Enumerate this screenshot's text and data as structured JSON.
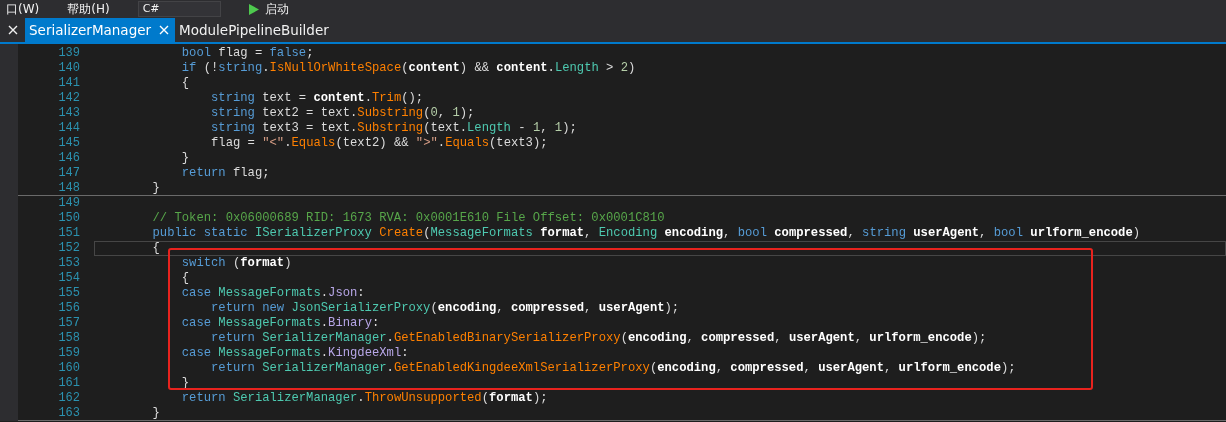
{
  "toolbar": {
    "menus": [
      "口(W)",
      "帮助(H)"
    ],
    "language": "C#",
    "run_label": "启动"
  },
  "tabs": [
    {
      "label": "SerializerManager",
      "selected": true,
      "closable": true
    },
    {
      "label": "ModulePipelineBuilder",
      "selected": false,
      "closable": false
    }
  ],
  "code_lines": [
    {
      "number": "139",
      "current": false,
      "boxed": false,
      "rule_after": false,
      "tokens": [
        {
          "text": "            bool",
          "kind": "kw"
        },
        {
          "text": " flag = ",
          "kind": "p"
        },
        {
          "text": "false",
          "kind": "kw"
        },
        {
          "text": ";",
          "kind": "p"
        }
      ]
    },
    {
      "number": "140",
      "current": false,
      "boxed": false,
      "rule_after": false,
      "tokens": [
        {
          "text": "            if",
          "kind": "kw"
        },
        {
          "text": " (!",
          "kind": "p"
        },
        {
          "text": "string",
          "kind": "kw"
        },
        {
          "text": ".",
          "kind": "p"
        },
        {
          "text": "IsNullOrWhiteSpace",
          "kind": "m"
        },
        {
          "text": "(",
          "kind": "p"
        },
        {
          "text": "content",
          "kind": "b"
        },
        {
          "text": ") && ",
          "kind": "p"
        },
        {
          "text": "content",
          "kind": "b"
        },
        {
          "text": ".",
          "kind": "p"
        },
        {
          "text": "Length",
          "kind": "t"
        },
        {
          "text": " > ",
          "kind": "p"
        },
        {
          "text": "2",
          "kind": "n"
        },
        {
          "text": ")",
          "kind": "p"
        }
      ]
    },
    {
      "number": "141",
      "current": false,
      "boxed": false,
      "rule_after": false,
      "tokens": [
        {
          "text": "            {",
          "kind": "p"
        }
      ]
    },
    {
      "number": "142",
      "current": false,
      "boxed": false,
      "rule_after": false,
      "tokens": [
        {
          "text": "                string",
          "kind": "kw"
        },
        {
          "text": " text = ",
          "kind": "p"
        },
        {
          "text": "content",
          "kind": "b"
        },
        {
          "text": ".",
          "kind": "p"
        },
        {
          "text": "Trim",
          "kind": "m"
        },
        {
          "text": "();",
          "kind": "p"
        }
      ]
    },
    {
      "number": "143",
      "current": false,
      "boxed": false,
      "rule_after": false,
      "tokens": [
        {
          "text": "                string",
          "kind": "kw"
        },
        {
          "text": " text2 = text.",
          "kind": "p"
        },
        {
          "text": "Substring",
          "kind": "m"
        },
        {
          "text": "(",
          "kind": "p"
        },
        {
          "text": "0",
          "kind": "n"
        },
        {
          "text": ", ",
          "kind": "p"
        },
        {
          "text": "1",
          "kind": "n"
        },
        {
          "text": ");",
          "kind": "p"
        }
      ]
    },
    {
      "number": "144",
      "current": false,
      "boxed": false,
      "rule_after": false,
      "tokens": [
        {
          "text": "                string",
          "kind": "kw"
        },
        {
          "text": " text3 = text.",
          "kind": "p"
        },
        {
          "text": "Substring",
          "kind": "m"
        },
        {
          "text": "(text.",
          "kind": "p"
        },
        {
          "text": "Length",
          "kind": "t"
        },
        {
          "text": " - ",
          "kind": "p"
        },
        {
          "text": "1",
          "kind": "n"
        },
        {
          "text": ", ",
          "kind": "p"
        },
        {
          "text": "1",
          "kind": "n"
        },
        {
          "text": ");",
          "kind": "p"
        }
      ]
    },
    {
      "number": "145",
      "current": false,
      "boxed": false,
      "rule_after": false,
      "tokens": [
        {
          "text": "                flag = ",
          "kind": "p"
        },
        {
          "text": "\"<\"",
          "kind": "s"
        },
        {
          "text": ".",
          "kind": "p"
        },
        {
          "text": "Equals",
          "kind": "m"
        },
        {
          "text": "(text2) && ",
          "kind": "p"
        },
        {
          "text": "\">\"",
          "kind": "s"
        },
        {
          "text": ".",
          "kind": "p"
        },
        {
          "text": "Equals",
          "kind": "m"
        },
        {
          "text": "(text3);",
          "kind": "p"
        }
      ]
    },
    {
      "number": "146",
      "current": false,
      "boxed": false,
      "rule_after": false,
      "tokens": [
        {
          "text": "            }",
          "kind": "p"
        }
      ]
    },
    {
      "number": "147",
      "current": false,
      "boxed": false,
      "rule_after": false,
      "tokens": [
        {
          "text": "            return",
          "kind": "kw"
        },
        {
          "text": " flag;",
          "kind": "p"
        }
      ]
    },
    {
      "number": "148",
      "current": false,
      "boxed": false,
      "rule_after": true,
      "tokens": [
        {
          "text": "        }",
          "kind": "p"
        }
      ]
    },
    {
      "number": "149",
      "current": false,
      "boxed": false,
      "rule_after": false
    },
    {
      "number": "150",
      "current": false,
      "boxed": false,
      "rule_after": false,
      "tokens": [
        {
          "text": "        // Token: 0x06000689 RID: 1673 RVA: 0x0001E610 File Offset: 0x0001C810",
          "kind": "c"
        }
      ]
    },
    {
      "number": "151",
      "current": false,
      "boxed": false,
      "rule_after": false,
      "tokens": [
        {
          "text": "        public static",
          "kind": "kw"
        },
        {
          "text": " ISerializerProxy",
          "kind": "t"
        },
        {
          "text": " Create",
          "kind": "m"
        },
        {
          "text": "(",
          "kind": "p"
        },
        {
          "text": "MessageFormats",
          "kind": "t"
        },
        {
          "text": " format",
          "kind": "b"
        },
        {
          "text": ", ",
          "kind": "p"
        },
        {
          "text": "Encoding",
          "kind": "t"
        },
        {
          "text": " encoding",
          "kind": "b"
        },
        {
          "text": ", ",
          "kind": "p"
        },
        {
          "text": "bool",
          "kind": "kw"
        },
        {
          "text": " compressed",
          "kind": "b"
        },
        {
          "text": ", ",
          "kind": "p"
        },
        {
          "text": "string",
          "kind": "kw"
        },
        {
          "text": " userAgent",
          "kind": "b"
        },
        {
          "text": ", ",
          "kind": "p"
        },
        {
          "text": "bool",
          "kind": "kw"
        },
        {
          "text": " urlform_encode",
          "kind": "b"
        },
        {
          "text": ")",
          "kind": "p"
        }
      ]
    },
    {
      "number": "152",
      "current": true,
      "boxed": false,
      "rule_after": false,
      "tokens": [
        {
          "text": "        {",
          "kind": "p"
        }
      ]
    },
    {
      "number": "153",
      "current": false,
      "boxed": true,
      "rule_after": false,
      "tokens": [
        {
          "text": "            switch",
          "kind": "kw"
        },
        {
          "text": " (",
          "kind": "p"
        },
        {
          "text": "format",
          "kind": "b"
        },
        {
          "text": ")",
          "kind": "p"
        }
      ]
    },
    {
      "number": "154",
      "current": false,
      "boxed": true,
      "rule_after": false,
      "tokens": [
        {
          "text": "            {",
          "kind": "p"
        }
      ]
    },
    {
      "number": "155",
      "current": false,
      "boxed": true,
      "rule_after": false,
      "tokens": [
        {
          "text": "            case",
          "kind": "kw"
        },
        {
          "text": " MessageFormats",
          "kind": "t"
        },
        {
          "text": ".",
          "kind": "p"
        },
        {
          "text": "Json",
          "kind": "e"
        },
        {
          "text": ":",
          "kind": "p"
        }
      ]
    },
    {
      "number": "156",
      "current": false,
      "boxed": true,
      "rule_after": false,
      "tokens": [
        {
          "text": "                return new",
          "kind": "kw"
        },
        {
          "text": " JsonSerializerProxy",
          "kind": "t"
        },
        {
          "text": "(",
          "kind": "p"
        },
        {
          "text": "encoding",
          "kind": "b"
        },
        {
          "text": ", ",
          "kind": "p"
        },
        {
          "text": "compressed",
          "kind": "b"
        },
        {
          "text": ", ",
          "kind": "p"
        },
        {
          "text": "userAgent",
          "kind": "b"
        },
        {
          "text": ");",
          "kind": "p"
        }
      ]
    },
    {
      "number": "157",
      "current": false,
      "boxed": true,
      "rule_after": false,
      "tokens": [
        {
          "text": "            case",
          "kind": "kw"
        },
        {
          "text": " MessageFormats",
          "kind": "t"
        },
        {
          "text": ".",
          "kind": "p"
        },
        {
          "text": "Binary",
          "kind": "e"
        },
        {
          "text": ":",
          "kind": "p"
        }
      ]
    },
    {
      "number": "158",
      "current": false,
      "boxed": true,
      "rule_after": false,
      "tokens": [
        {
          "text": "                return",
          "kind": "kw"
        },
        {
          "text": " SerializerManager",
          "kind": "t"
        },
        {
          "text": ".",
          "kind": "p"
        },
        {
          "text": "GetEnabledBinarySerializerProxy",
          "kind": "m"
        },
        {
          "text": "(",
          "kind": "p"
        },
        {
          "text": "encoding",
          "kind": "b"
        },
        {
          "text": ", ",
          "kind": "p"
        },
        {
          "text": "compressed",
          "kind": "b"
        },
        {
          "text": ", ",
          "kind": "p"
        },
        {
          "text": "userAgent",
          "kind": "b"
        },
        {
          "text": ", ",
          "kind": "p"
        },
        {
          "text": "urlform_encode",
          "kind": "b"
        },
        {
          "text": ");",
          "kind": "p"
        }
      ]
    },
    {
      "number": "159",
      "current": false,
      "boxed": true,
      "rule_after": false,
      "tokens": [
        {
          "text": "            case",
          "kind": "kw"
        },
        {
          "text": " MessageFormats",
          "kind": "t"
        },
        {
          "text": ".",
          "kind": "p"
        },
        {
          "text": "KingdeeXml",
          "kind": "e"
        },
        {
          "text": ":",
          "kind": "p"
        }
      ]
    },
    {
      "number": "160",
      "current": false,
      "boxed": true,
      "rule_after": false,
      "tokens": [
        {
          "text": "                return",
          "kind": "kw"
        },
        {
          "text": " SerializerManager",
          "kind": "t"
        },
        {
          "text": ".",
          "kind": "p"
        },
        {
          "text": "GetEnabledKingdeeXmlSerializerProxy",
          "kind": "m"
        },
        {
          "text": "(",
          "kind": "p"
        },
        {
          "text": "encoding",
          "kind": "b"
        },
        {
          "text": ", ",
          "kind": "p"
        },
        {
          "text": "compressed",
          "kind": "b"
        },
        {
          "text": ", ",
          "kind": "p"
        },
        {
          "text": "userAgent",
          "kind": "b"
        },
        {
          "text": ", ",
          "kind": "p"
        },
        {
          "text": "urlform_encode",
          "kind": "b"
        },
        {
          "text": ");",
          "kind": "p"
        }
      ]
    },
    {
      "number": "161",
      "current": false,
      "boxed": true,
      "rule_after": false,
      "tokens": [
        {
          "text": "            }",
          "kind": "p"
        }
      ]
    },
    {
      "number": "162",
      "current": false,
      "boxed": false,
      "rule_after": false,
      "tokens": [
        {
          "text": "            return",
          "kind": "kw"
        },
        {
          "text": " SerializerManager",
          "kind": "t"
        },
        {
          "text": ".",
          "kind": "p"
        },
        {
          "text": "ThrowUnsupported",
          "kind": "m"
        },
        {
          "text": "(",
          "kind": "p"
        },
        {
          "text": "format",
          "kind": "b"
        },
        {
          "text": ");",
          "kind": "p"
        }
      ]
    },
    {
      "number": "163",
      "current": false,
      "boxed": false,
      "rule_after": true,
      "tokens": [
        {
          "text": "        }",
          "kind": "p"
        }
      ]
    }
  ]
}
